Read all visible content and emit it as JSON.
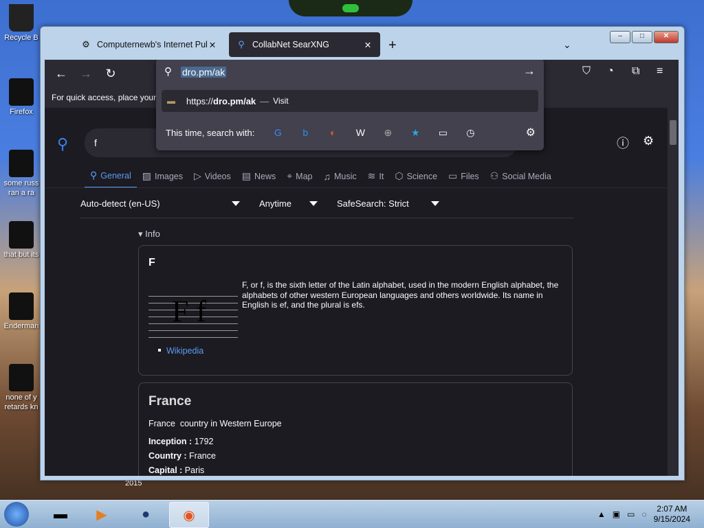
{
  "desktop": {
    "icons": [
      {
        "label": "Recycle B",
        "name": "recycle-bin"
      },
      {
        "label": "Firefox",
        "name": "firefox"
      },
      {
        "label": "some russ\nran a ra",
        "name": "file-a"
      },
      {
        "label": "that but its",
        "name": "file-b"
      },
      {
        "label": "Enderman",
        "name": "enderman"
      },
      {
        "label": "none of y\nretards kn",
        "name": "file-c"
      }
    ],
    "year_label": "2015"
  },
  "window": {
    "controls": {
      "minimize": "–",
      "maximize": "□",
      "close": "✕"
    }
  },
  "tabs": [
    {
      "title": "Computernewb's Internet Pub",
      "icon": "⚙",
      "close": "✕"
    },
    {
      "title": "CollabNet SearXNG",
      "icon": "⚲",
      "close": "✕"
    }
  ],
  "newtab": "+",
  "tablist": "⌄",
  "toolbar": {
    "back": "←",
    "forward": "→",
    "reload": "↻"
  },
  "bookmarks_text": "For quick access, place your l",
  "urlbar": {
    "value": "dro.pm/ak",
    "go": "→",
    "suggestion": {
      "prefix": "https://",
      "bold": "dro.pm/ak",
      "sep": "—",
      "action": "Visit"
    },
    "search_with": "This time, search with:",
    "engines": [
      "G",
      "b",
      "◐",
      "W",
      "⊕",
      "★",
      "▭",
      "◷"
    ],
    "settings": "⚙"
  },
  "searx": {
    "query": "f",
    "categories": [
      {
        "label": "General",
        "icon": "⚲",
        "active": true
      },
      {
        "label": "Images",
        "icon": "▨"
      },
      {
        "label": "Videos",
        "icon": "▷"
      },
      {
        "label": "News",
        "icon": "▤"
      },
      {
        "label": "Map",
        "icon": "⌖"
      },
      {
        "label": "Music",
        "icon": "♫"
      },
      {
        "label": "It",
        "icon": "≋"
      },
      {
        "label": "Science",
        "icon": "⬡"
      },
      {
        "label": "Files",
        "icon": "▭"
      },
      {
        "label": "Social Media",
        "icon": "⚇"
      }
    ],
    "filters": {
      "lang": "Auto-detect (en-US)",
      "time": "Anytime",
      "safe": "SafeSearch: Strict"
    },
    "info_toggle": "▾ Info",
    "card1": {
      "title": "F",
      "image_text": "F f",
      "desc": "F, or f, is the sixth letter of the Latin alphabet, used in the modern English alphabet, the alphabets of other western European languages and others worldwide. Its name in English is ef, and the plural is efs.",
      "link": "Wikipedia"
    },
    "card2": {
      "title": "France",
      "subject": "France",
      "subtitle": "country in Western Europe",
      "rows": [
        {
          "k": "Inception :",
          "v": "1792"
        },
        {
          "k": "Country :",
          "v": "France"
        },
        {
          "k": "Capital :",
          "v": "Paris"
        }
      ]
    }
  },
  "taskbar": {
    "clock_time": "2:07 AM",
    "clock_date": "9/15/2024",
    "tray_expand": "▲"
  }
}
